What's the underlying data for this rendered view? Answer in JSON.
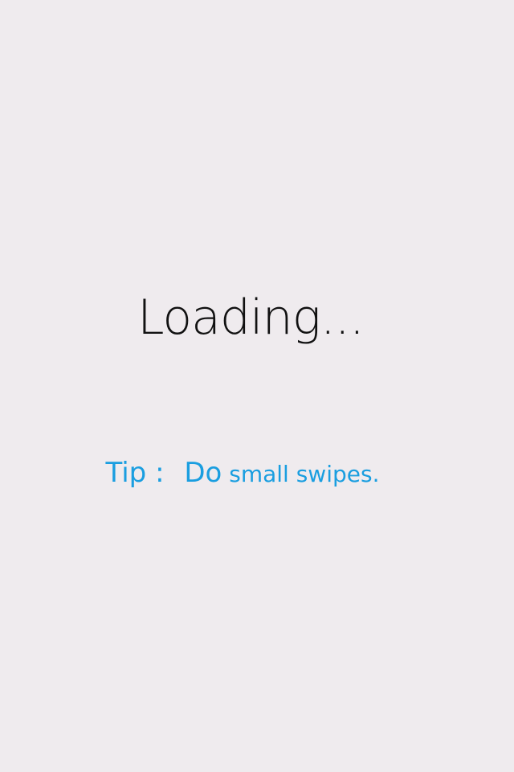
{
  "loading": {
    "text": "Loading..."
  },
  "tip": {
    "label": "Tip :",
    "first_word": "Do",
    "rest": "small swipes."
  },
  "colors": {
    "background": "#efebee",
    "loading_text": "#111111",
    "tip_text": "#1a9ee0"
  }
}
